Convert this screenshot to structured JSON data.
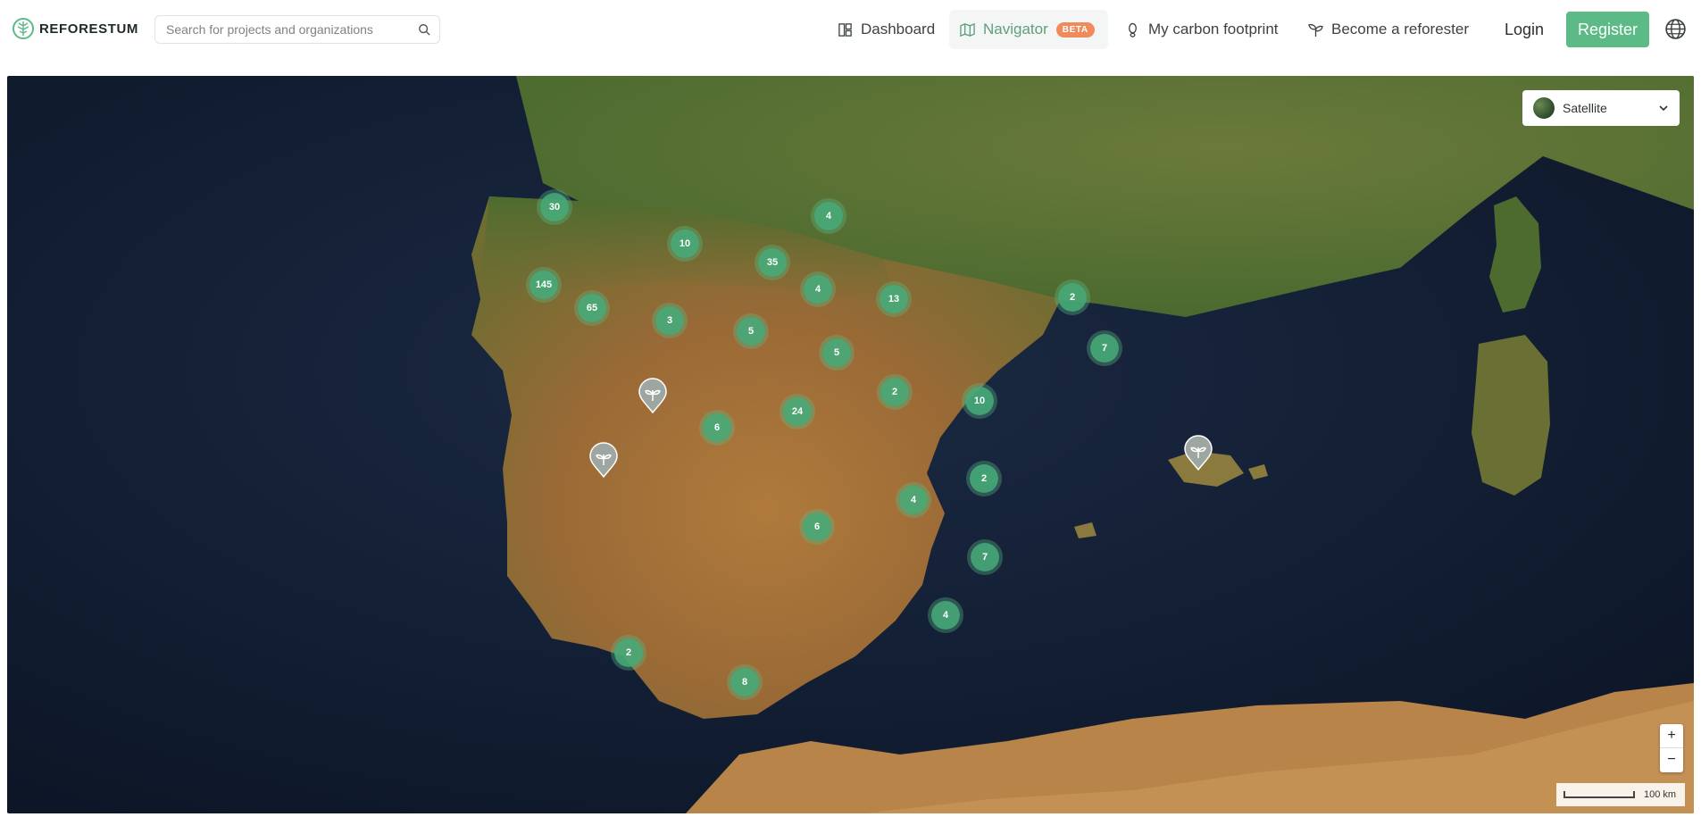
{
  "brand": {
    "name": "REFORESTUM",
    "accent": "#5cba86"
  },
  "search": {
    "placeholder": "Search for projects and organizations",
    "icon": "search-icon"
  },
  "nav": {
    "dashboard": "Dashboard",
    "navigator": "Navigator",
    "navigator_badge": "BETA",
    "carbon": "My carbon footprint",
    "reforester": "Become a reforester"
  },
  "auth": {
    "login": "Login",
    "register": "Register"
  },
  "map": {
    "style_selector": "Satellite",
    "zoom_in": "+",
    "zoom_out": "−",
    "scale": "100 km",
    "clusters": [
      "30",
      "4",
      "10",
      "35",
      "145",
      "65",
      "4",
      "13",
      "2",
      "3",
      "5",
      "5",
      "7",
      "2",
      "10",
      "24",
      "6",
      "2",
      "4",
      "6",
      "7",
      "4",
      "2",
      "8"
    ],
    "markers": [
      "project-pin",
      "project-pin",
      "project-pin"
    ]
  }
}
